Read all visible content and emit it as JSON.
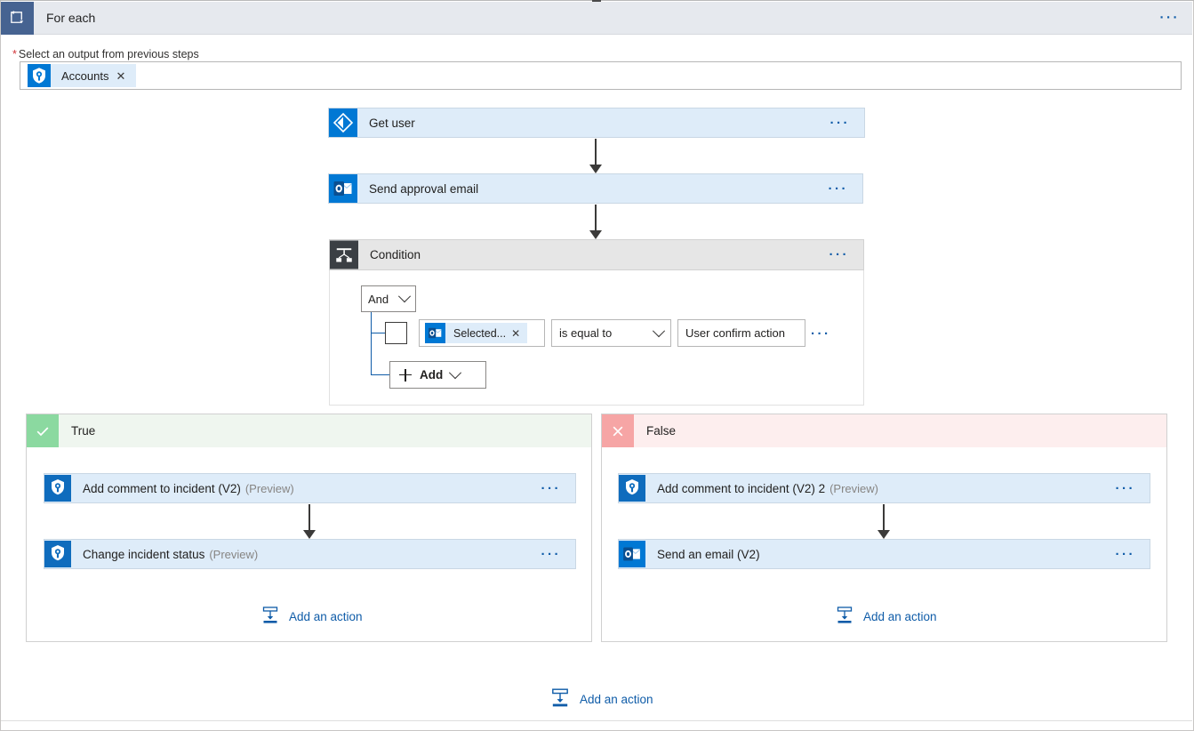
{
  "header": {
    "title": "For each",
    "icon": "loop-icon",
    "overflow_label": "···"
  },
  "input_section": {
    "required_marker": "*",
    "label": "Select an output from previous steps",
    "token": {
      "text": "Accounts",
      "remove_label": "✕",
      "icon": "azure-sentinel-shield-icon"
    }
  },
  "flow": {
    "steps": [
      {
        "title": "Get user",
        "subtitle": "",
        "icon": "azure-ad-icon",
        "overflow_label": "···"
      },
      {
        "title": "Send approval email",
        "subtitle": "",
        "icon": "outlook-icon",
        "overflow_label": "···"
      },
      {
        "title": "Condition",
        "subtitle": "",
        "icon": "condition-branch-icon",
        "overflow_label": "···"
      }
    ]
  },
  "condition": {
    "operator_group": {
      "value": "And",
      "chevron": "chevron-down-icon"
    },
    "row": {
      "checkbox_checked": false,
      "token": {
        "text": "Selected...",
        "remove_label": "✕",
        "icon": "outlook-icon"
      },
      "operator": "is equal to",
      "operator_chevron": "chevron-down-icon",
      "value": "User confirm action",
      "overflow_label": "···"
    },
    "add_button": {
      "label": "Add",
      "plus_icon": "plus-icon",
      "chevron": "chevron-down-icon"
    }
  },
  "branches": {
    "true": {
      "label": "True",
      "icon": "checkmark-icon",
      "accent": "#8bd9a0",
      "background": "#eff6ef",
      "actions": [
        {
          "title": "Add comment to incident (V2)",
          "subtitle": "(Preview)",
          "icon": "azure-sentinel-shield-icon",
          "overflow_label": "···"
        },
        {
          "title": "Change incident status",
          "subtitle": "(Preview)",
          "icon": "azure-sentinel-shield-icon",
          "overflow_label": "···"
        }
      ],
      "add_action": {
        "label": "Add an action",
        "icon": "add-action-icon"
      }
    },
    "false": {
      "label": "False",
      "icon": "cross-icon",
      "accent": "#f6a5a5",
      "background": "#fdeeee",
      "actions": [
        {
          "title": "Add comment to incident (V2) 2",
          "subtitle": "(Preview)",
          "icon": "azure-sentinel-shield-icon",
          "overflow_label": "···"
        },
        {
          "title": "Send an email (V2)",
          "subtitle": "",
          "icon": "outlook-icon",
          "overflow_label": "···"
        }
      ],
      "add_action": {
        "label": "Add an action",
        "icon": "add-action-icon"
      }
    }
  },
  "footer": {
    "add_action": {
      "label": "Add an action",
      "icon": "add-action-icon"
    }
  },
  "colors": {
    "card_background": "#deecf9",
    "card_border": "#c9d7e4",
    "link": "#0f5ca8",
    "required": "#d13438",
    "header_background": "#e6e9ee",
    "header_icon_background": "#466391"
  }
}
